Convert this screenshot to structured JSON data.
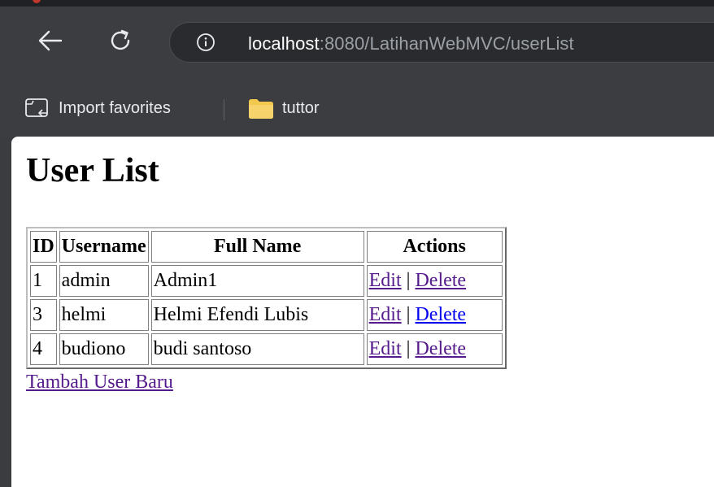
{
  "browser": {
    "address": {
      "host": "localhost",
      "rest": ":8080/LatihanWebMVC/userList"
    },
    "bookmarks": [
      {
        "label": "Import favorites",
        "icon": "import-favorites-icon"
      },
      {
        "label": "tuttor",
        "icon": "folder-icon"
      }
    ],
    "colors": {
      "toolbar": "#3c3d41",
      "folder": "#f2c94c"
    }
  },
  "page": {
    "title": "User List",
    "table": {
      "headers": [
        "ID",
        "Username",
        "Full Name",
        "Actions"
      ],
      "rows": [
        {
          "id": "1",
          "username": "admin",
          "full_name": "Admin1",
          "edit": "Edit",
          "sep": "|",
          "delete": "Delete"
        },
        {
          "id": "3",
          "username": "helmi",
          "full_name": "Helmi Efendi Lubis",
          "edit": "Edit",
          "sep": "|",
          "delete": "Delete"
        },
        {
          "id": "4",
          "username": "budiono",
          "full_name": "budi santoso",
          "edit": "Edit",
          "sep": "|",
          "delete": "Delete"
        }
      ]
    },
    "add_link": "Tambah User Baru"
  }
}
